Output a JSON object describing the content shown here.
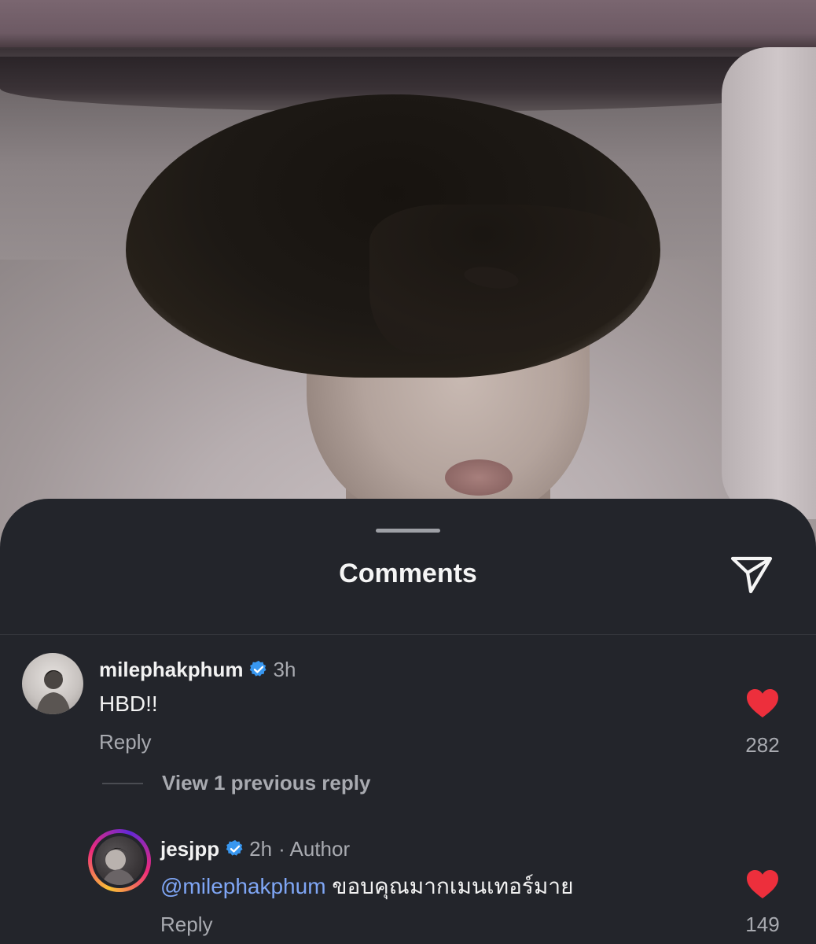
{
  "sheet": {
    "title": "Comments",
    "share_icon": "paper-plane-icon"
  },
  "comments": [
    {
      "username": "milephakphum",
      "verified": true,
      "time": "3h",
      "text": "HBD!!",
      "reply_label": "Reply",
      "likes": "282",
      "liked": true
    }
  ],
  "view_replies_label": "View 1 previous reply",
  "replies": [
    {
      "username": "jesjpp",
      "verified": true,
      "time": "2h",
      "author_badge": "· Author",
      "mention": "@milephakphum",
      "text": "ขอบคุณมากเมนเทอร์มาย",
      "reply_label": "Reply",
      "likes": "149",
      "liked": true
    }
  ],
  "colors": {
    "background": "#23252b",
    "like_red": "#ed2f3c",
    "verified_blue": "#3897f0",
    "mention_blue": "#7fa6f5",
    "story_ring": [
      "#f9c235",
      "#ee2a7b",
      "#6228d7"
    ]
  }
}
